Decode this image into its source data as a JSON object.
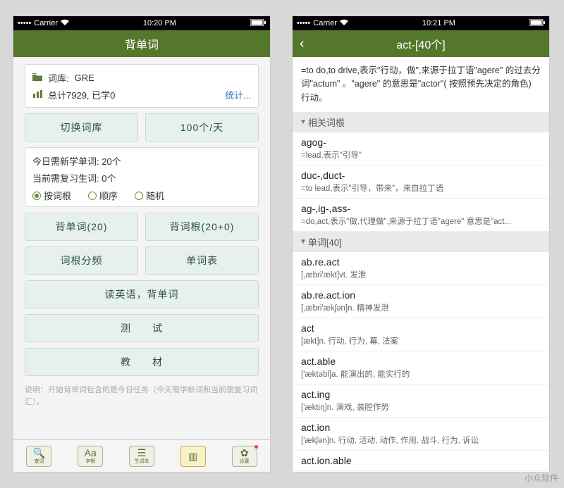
{
  "statusbar": {
    "carrier": "Carrier",
    "time_left": "10:20 PM",
    "time_right": "10:21 PM"
  },
  "left": {
    "title": "背单词",
    "card1": {
      "lib_label": "词库:",
      "lib_value": "GRE",
      "stats_text": "总计7929, 已学0",
      "stats_link": "统计..."
    },
    "row_buttons": {
      "switch": "切换词库",
      "daily": "100个/天"
    },
    "card2": {
      "line1": "今日需新学单词: 20个",
      "line2": "当前需复习生词: 0个",
      "radios": [
        "按词根",
        "顺序",
        "随机"
      ]
    },
    "btn_row2": {
      "a": "背单词(20)",
      "b": "背词根(20+0)"
    },
    "btn_row3": {
      "a": "词根分频",
      "b": "单词表"
    },
    "btn4": "读英语，背单词",
    "btn5": "测　　试",
    "btn6": "教　　材",
    "note": "说明：开始背单词包含的是今日任务（今天需学新词和当前需复习词汇）。",
    "tabs": [
      "查词",
      "字根",
      "生词本",
      "",
      "设置"
    ]
  },
  "right": {
    "title": "act-[40个]",
    "desc": "=to do,to drive,表示\"行动，做\",来源于拉丁语\"agere\" 的过去分词\"actum\" 。\"agere\" 的意思是\"actor\"( 按照预先决定的角色) 行动。",
    "sect1": "相关词根",
    "roots": [
      {
        "h": "agog-",
        "m": "=lead,表示\"引导\""
      },
      {
        "h": "duc-,duct-",
        "m": "=to lead,表示\"引导，带来\"，来自拉丁语"
      },
      {
        "h": "ag-,ig-,ass-",
        "m": "=do,act,表示\"做,代理做\",来源于拉丁语\"agere\" 意思是\"act..."
      }
    ],
    "sect2": "单词[40]",
    "words": [
      {
        "h": "ab.re.act",
        "m": "[,æbri'ækt]vt. 发泄"
      },
      {
        "h": "ab.re.act.ion",
        "m": "[,æbri'ækʃən]n. 精神发泄"
      },
      {
        "h": "act",
        "m": "[ækt]n. 行动, 行为, 幕, 法案"
      },
      {
        "h": "act.able",
        "m": "['æktəbl]a. 能演出的, 能实行的"
      },
      {
        "h": "act.ing",
        "m": "['æktiŋ]n. 演戏, 装腔作势"
      },
      {
        "h": "act.ion",
        "m": "['ækʃən]n. 行动, 活动, 动作, 作用, 战斗, 行为, 诉讼"
      },
      {
        "h": "act.ion.able",
        "m": ""
      }
    ]
  },
  "watermark": "小众软件"
}
